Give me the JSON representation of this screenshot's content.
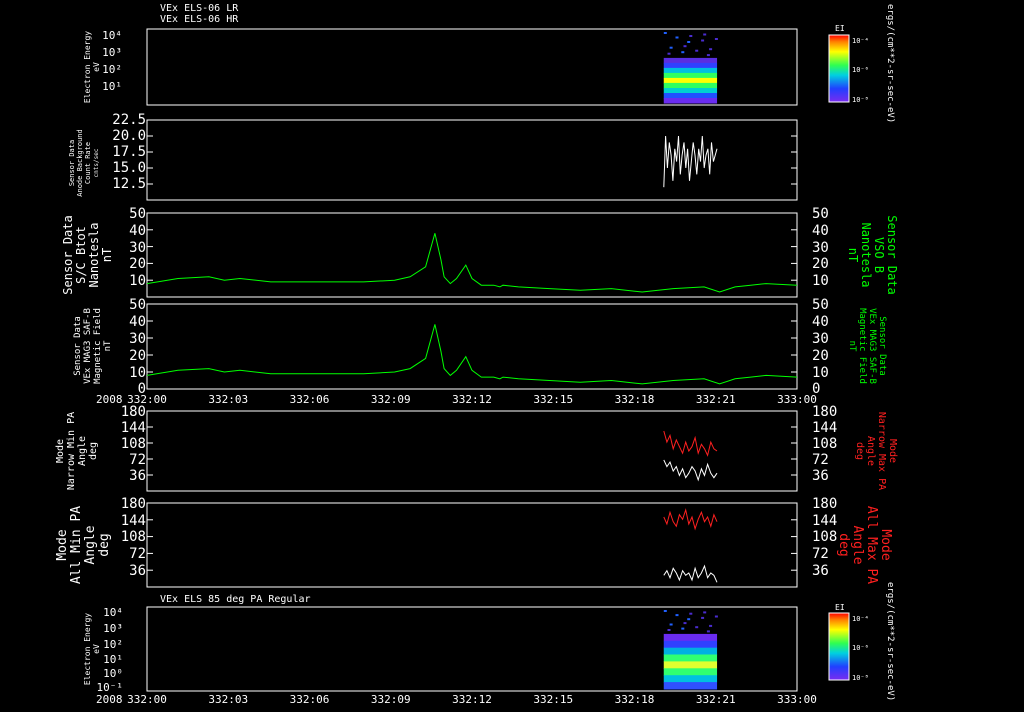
{
  "header": {
    "line1": "VEx ELS-06 LR",
    "line2": "VEx ELS-06 HR"
  },
  "bottom_header": "VEx ELS 85 deg PA Regular",
  "year": "2008",
  "time_ticks": [
    "332:00",
    "332:03",
    "332:06",
    "332:09",
    "332:12",
    "332:15",
    "332:18",
    "332:21",
    "333:00"
  ],
  "colors": {
    "green": "#00ff00",
    "red": "#ff2020",
    "white": "#ffffff"
  },
  "colorbar": {
    "title": "EI",
    "units": "ergs/(cm**2-sr-sec-eV)",
    "tick_top": "10⁻⁴",
    "tick_mid": "10⁻⁶",
    "tick_bot": "10⁻⁸"
  },
  "chart_data": [
    {
      "type": "heatmap",
      "panel": "top-spectrogram",
      "ylabel": [
        "Electron Energy",
        "eV"
      ],
      "yticks": [
        "10⁴",
        "10³",
        "10²",
        "10¹"
      ],
      "scale": "log",
      "data_window": [
        "332:18.8",
        "332:21"
      ],
      "bands_low_to_high_energy": [
        "#6a2cf0",
        "#2050ff",
        "#00d0d0",
        "#30ff60",
        "#ffff00",
        "#30ff60",
        "#00c0e0",
        "#3040ff",
        "#5a2ee0"
      ]
    },
    {
      "type": "line",
      "panel": "anode-background",
      "ylabel": [
        "Sensor Data",
        "Anode Background",
        "Count Rate",
        "cnts/sec"
      ],
      "yticks": [
        "22.5",
        "20.0",
        "17.5",
        "15.0",
        "12.5"
      ],
      "ylim": [
        10,
        22.5
      ],
      "x_range": [
        "332:18.8",
        "332:21"
      ],
      "values": [
        12,
        20,
        15,
        19,
        17,
        13,
        18,
        16,
        20,
        14,
        17,
        19,
        15,
        18,
        13,
        16,
        19,
        17,
        14,
        18,
        16,
        20,
        15,
        17,
        18,
        14,
        19,
        16,
        17,
        18
      ]
    },
    {
      "type": "line",
      "panel": "sc-bmag",
      "ylabel": [
        "Sensor Data",
        "S/C Btot",
        "Nanotesla",
        "nT"
      ],
      "right_label": [
        "Sensor Data",
        "VSO B",
        "Nanotesla",
        "nT"
      ],
      "yticks": [
        "50",
        "40",
        "30",
        "20",
        "10"
      ],
      "ylim": [
        0,
        50
      ],
      "x": [
        0,
        10,
        20,
        25,
        30,
        40,
        50,
        60,
        70,
        80,
        85,
        90,
        93,
        95,
        96,
        98,
        100,
        103,
        105,
        108,
        112,
        114,
        115,
        120,
        130,
        140,
        150,
        160,
        170,
        180,
        185,
        190,
        195,
        200,
        210
      ],
      "values": [
        8,
        11,
        12,
        10,
        11,
        9,
        9,
        9,
        9,
        10,
        12,
        18,
        38,
        22,
        12,
        8,
        11,
        19,
        11,
        7,
        7,
        6,
        7,
        6,
        5,
        4,
        5,
        3,
        5,
        6,
        3,
        6,
        7,
        8,
        7
      ]
    },
    {
      "type": "line",
      "panel": "mag-saf-b",
      "ylabel": [
        "Sensor Data",
        "VEx MAG3 SAF-B",
        "Magnetic Field",
        "nT"
      ],
      "right_label": [
        "Sensor Data",
        "VEx MAG3 SAF-B",
        "Magnetic Field",
        "nT"
      ],
      "yticks": [
        "50",
        "40",
        "30",
        "20",
        "10",
        "0"
      ],
      "ylim": [
        0,
        50
      ],
      "x": [
        0,
        10,
        20,
        25,
        30,
        40,
        50,
        60,
        70,
        80,
        85,
        90,
        93,
        95,
        96,
        98,
        100,
        103,
        105,
        108,
        112,
        114,
        115,
        120,
        130,
        140,
        150,
        160,
        170,
        180,
        185,
        190,
        195,
        200,
        210
      ],
      "values": [
        8,
        11,
        12,
        10,
        11,
        9,
        9,
        9,
        9,
        10,
        12,
        18,
        38,
        22,
        12,
        8,
        11,
        19,
        11,
        7,
        7,
        6,
        7,
        6,
        5,
        4,
        5,
        3,
        5,
        6,
        3,
        6,
        7,
        8,
        7
      ]
    },
    {
      "type": "line",
      "panel": "narrow-pa",
      "ylabel": [
        "Mode",
        "Narrow Min PA",
        "Angle",
        "deg"
      ],
      "right_label": [
        "Mode",
        "Narrow Max PA",
        "Angle",
        "deg"
      ],
      "yticks": [
        "180",
        "144",
        "108",
        "72",
        "36"
      ],
      "ylim": [
        0,
        180
      ],
      "series": [
        {
          "color": "red",
          "values": [
            135,
            110,
            125,
            95,
            115,
            100,
            85,
            110,
            90,
            100,
            120,
            85,
            105,
            95,
            80,
            110,
            95,
            90
          ]
        },
        {
          "color": "white",
          "values": [
            70,
            55,
            65,
            45,
            55,
            35,
            50,
            30,
            40,
            55,
            45,
            25,
            50,
            35,
            60,
            40,
            30,
            40
          ]
        }
      ]
    },
    {
      "type": "line",
      "panel": "all-pa",
      "ylabel": [
        "Mode",
        "All Min PA",
        "Angle",
        "deg"
      ],
      "right_label": [
        "Mode",
        "All Max PA",
        "Angle",
        "deg"
      ],
      "yticks": [
        "180",
        "144",
        "108",
        "72",
        "36"
      ],
      "ylim": [
        0,
        180
      ],
      "series": [
        {
          "color": "red",
          "values": [
            150,
            135,
            160,
            140,
            130,
            155,
            145,
            165,
            135,
            150,
            125,
            145,
            160,
            140,
            150,
            130,
            155,
            140
          ]
        },
        {
          "color": "white",
          "values": [
            25,
            35,
            20,
            40,
            30,
            15,
            35,
            25,
            30,
            15,
            40,
            20,
            30,
            45,
            20,
            30,
            25,
            10
          ]
        }
      ]
    },
    {
      "type": "heatmap",
      "panel": "bottom-spectrogram",
      "ylabel": [
        "Electron Energy",
        "eV"
      ],
      "yticks": [
        "10⁴",
        "10³",
        "10²",
        "10¹",
        "10⁰",
        "10⁻¹"
      ],
      "scale": "log",
      "data_window": [
        "332:18.8",
        "332:21"
      ],
      "bands_low_to_high_energy": [
        "#3050ff",
        "#00c0e0",
        "#30ff70",
        "#e0ff30",
        "#30ff70",
        "#00b0e0",
        "#3040ff",
        "#6a2cf0"
      ]
    }
  ]
}
